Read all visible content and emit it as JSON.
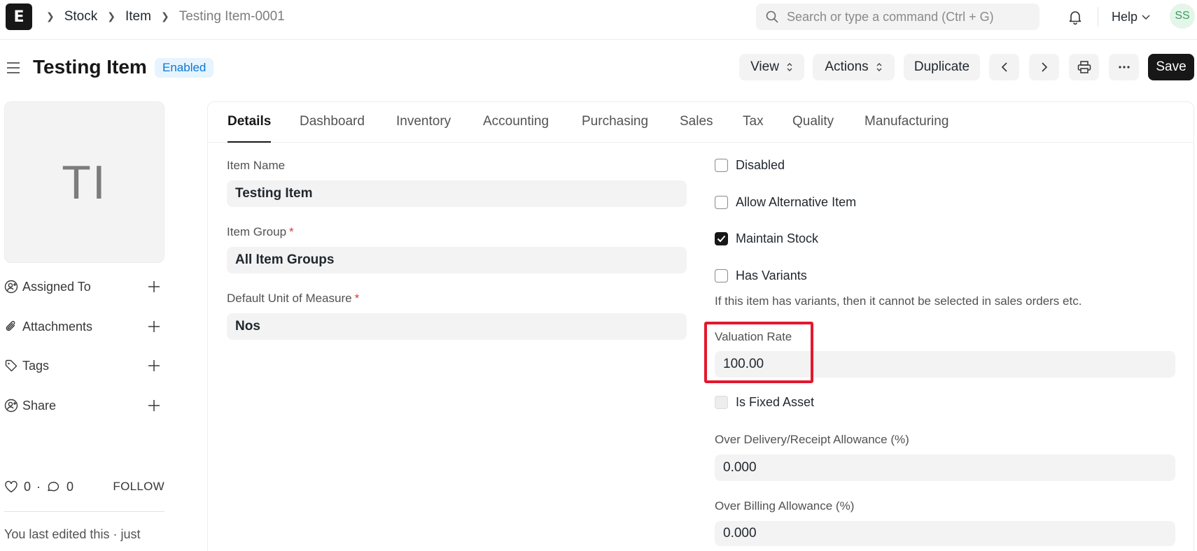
{
  "navbar": {
    "logo_letter": "E",
    "breadcrumbs": [
      "Stock",
      "Item",
      "Testing Item-0001"
    ],
    "search_placeholder": "Search or type a command (Ctrl + G)",
    "help_label": "Help",
    "user_initials": "SS"
  },
  "page_head": {
    "title": "Testing Item",
    "status": "Enabled",
    "view_label": "View",
    "actions_label": "Actions",
    "duplicate_label": "Duplicate",
    "save_label": "Save"
  },
  "sidebar": {
    "image_initials": "TI",
    "items": [
      {
        "label": "Assigned To",
        "icon": "user-plus-icon"
      },
      {
        "label": "Attachments",
        "icon": "paperclip-icon"
      },
      {
        "label": "Tags",
        "icon": "tag-icon"
      },
      {
        "label": "Share",
        "icon": "share-user-icon"
      }
    ],
    "likes": "0",
    "dot": "·",
    "comments": "0",
    "follow_label": "FOLLOW",
    "last_edited": "You last edited this · just"
  },
  "tabs": [
    "Details",
    "Dashboard",
    "Inventory",
    "Accounting",
    "Purchasing",
    "Sales",
    "Tax",
    "Quality",
    "Manufacturing"
  ],
  "active_tab": "Details",
  "form": {
    "item_name_label": "Item Name",
    "item_name_value": "Testing Item",
    "item_group_label": "Item Group",
    "item_group_value": "All Item Groups",
    "uom_label": "Default Unit of Measure",
    "uom_value": "Nos",
    "required_mark": "*",
    "disabled_label": "Disabled",
    "allow_alt_label": "Allow Alternative Item",
    "maintain_stock_label": "Maintain Stock",
    "has_variants_label": "Has Variants",
    "variants_help": "If this item has variants, then it cannot be selected in sales orders etc.",
    "valuation_rate_label": "Valuation Rate",
    "valuation_rate_value": "100.00",
    "fixed_asset_label": "Is Fixed Asset",
    "over_delivery_label": "Over Delivery/Receipt Allowance (%)",
    "over_delivery_value": "0.000",
    "over_billing_label": "Over Billing Allowance (%)",
    "over_billing_value": "0.000"
  },
  "checks": {
    "disabled": false,
    "allow_alternative_item": false,
    "maintain_stock": true,
    "has_variants": false,
    "is_fixed_asset": false
  },
  "colors": {
    "primary": "#171717",
    "badge_text": "#0b78d1",
    "badge_bg": "#e6f4ff",
    "highlight": "#e3182d",
    "required": "#e03636"
  }
}
